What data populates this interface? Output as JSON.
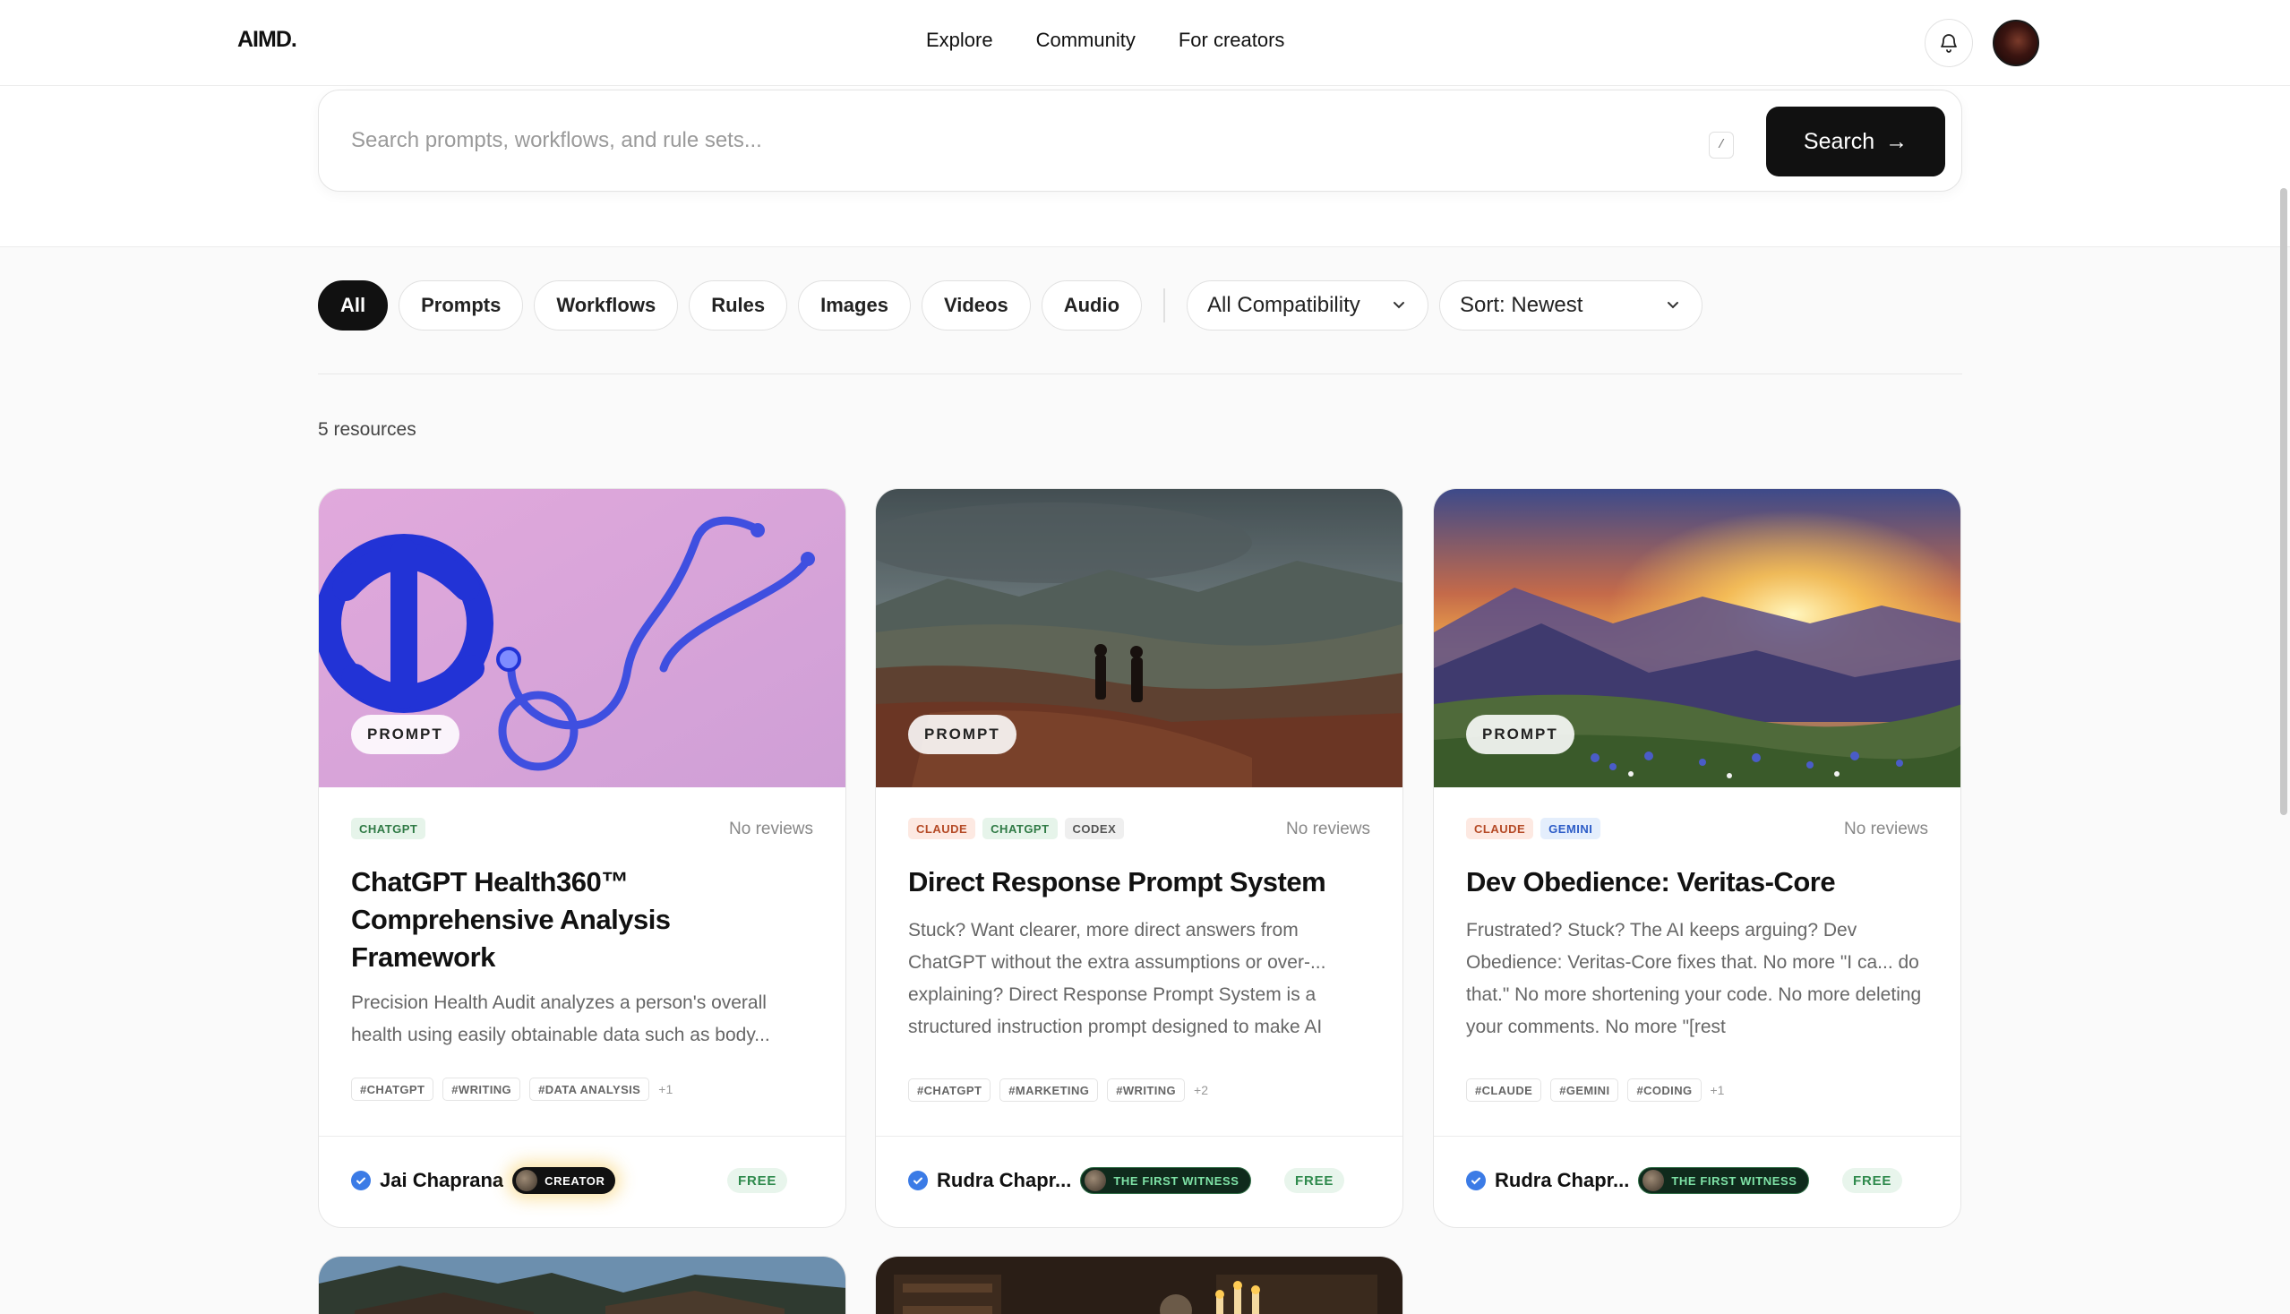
{
  "nav": {
    "logo": "AIMD.",
    "links": [
      "Explore",
      "Community",
      "For creators"
    ]
  },
  "search": {
    "placeholder": "Search prompts, workflows, and rule sets...",
    "shortcut": "/",
    "button_label": "Search",
    "button_arrow": "→"
  },
  "filters": {
    "chips": [
      "All",
      "Prompts",
      "Workflows",
      "Rules",
      "Images",
      "Videos",
      "Audio"
    ],
    "active": "All",
    "compatibility": "All Compatibility",
    "sort": "Sort: Newest"
  },
  "results": {
    "count_label": "5 resources"
  },
  "cards": [
    {
      "type": "PROMPT",
      "compat": [
        {
          "label": "CHATGPT",
          "kind": "chatgpt"
        }
      ],
      "reviews": "No reviews",
      "title": "ChatGPT Health360™ Comprehensive Analysis Framework",
      "description": "Precision Health Audit analyzes a person's overall health using easily obtainable data such as body...",
      "hashtags": [
        "#CHATGPT",
        "#WRITING",
        "#DATA ANALYSIS"
      ],
      "more": "+1",
      "author": "Jai Chaprana",
      "role": "CREATOR",
      "price": "FREE"
    },
    {
      "type": "PROMPT",
      "compat": [
        {
          "label": "CLAUDE",
          "kind": "claude"
        },
        {
          "label": "CHATGPT",
          "kind": "chatgpt"
        },
        {
          "label": "CODEX",
          "kind": "codex"
        }
      ],
      "reviews": "No reviews",
      "title": "Direct Response Prompt System",
      "description": "Stuck? Want clearer, more direct answers from ChatGPT without the extra assumptions or over-... explaining? Direct Response Prompt System is a structured instruction prompt designed to make AI",
      "hashtags": [
        "#CHATGPT",
        "#MARKETING",
        "#WRITING"
      ],
      "more": "+2",
      "author": "Rudra Chapr...",
      "role": "THE FIRST WITNESS",
      "price": "FREE"
    },
    {
      "type": "PROMPT",
      "compat": [
        {
          "label": "CLAUDE",
          "kind": "claude"
        },
        {
          "label": "GEMINI",
          "kind": "gemini"
        }
      ],
      "reviews": "No reviews",
      "title": "Dev Obedience: Veritas-Core",
      "description": "Frustrated? Stuck? The AI keeps arguing? Dev Obedience: Veritas-Core fixes that. No more \"I ca... do that.\" No more shortening your code. No more deleting your comments. No more \"[rest",
      "hashtags": [
        "#CLAUDE",
        "#GEMINI",
        "#CODING"
      ],
      "more": "+1",
      "author": "Rudra Chapr...",
      "role": "THE FIRST WITNESS",
      "price": "FREE"
    }
  ]
}
